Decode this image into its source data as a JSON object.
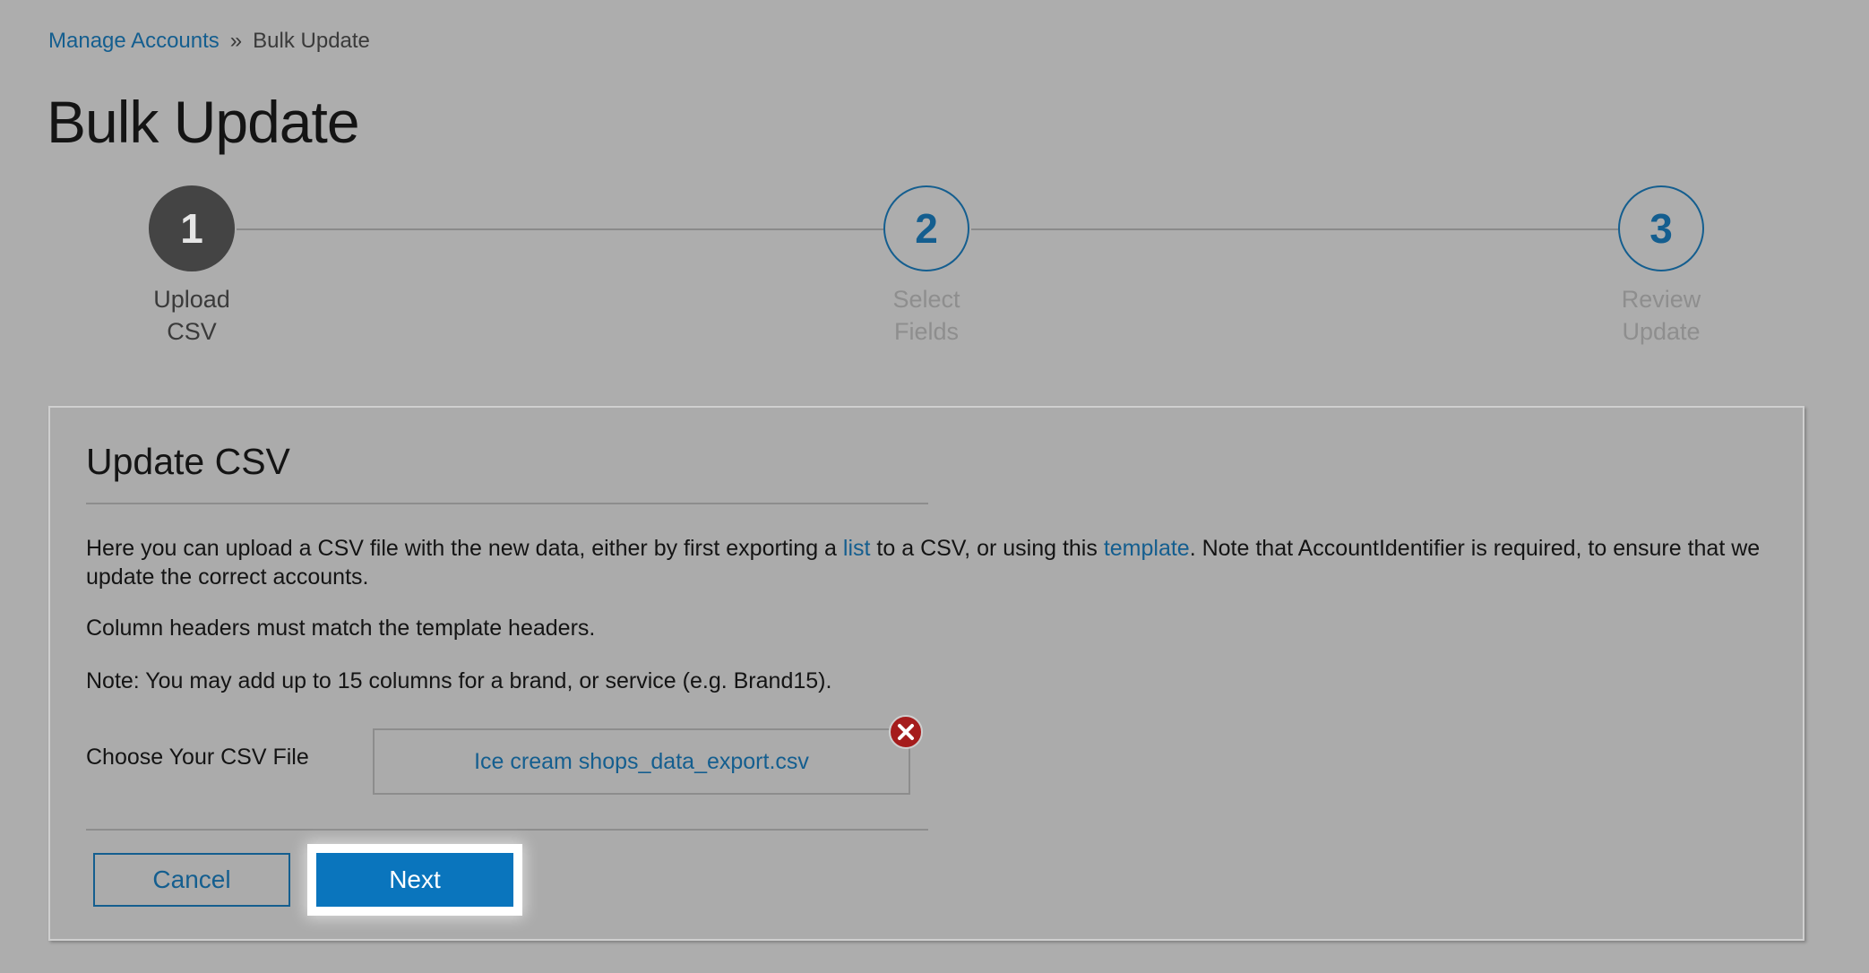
{
  "breadcrumb": {
    "parent": "Manage Accounts",
    "separator": "»",
    "current": "Bulk Update"
  },
  "page_title": "Bulk Update",
  "stepper": {
    "steps": [
      {
        "number": "1",
        "line1": "Upload",
        "line2": "CSV",
        "state": "active"
      },
      {
        "number": "2",
        "line1": "Select",
        "line2": "Fields",
        "state": "pending"
      },
      {
        "number": "3",
        "line1": "Review",
        "line2": "Update",
        "state": "pending"
      }
    ]
  },
  "card": {
    "title": "Update CSV",
    "desc1": {
      "part1": "Here you can upload a CSV file with the new data, either by first exporting a ",
      "link1": "list",
      "part2": " to a CSV, or using this ",
      "link2": "template",
      "part3": ". Note that AccountIdentifier is required, to ensure that we update the correct accounts."
    },
    "desc2": "Column headers must match the template headers.",
    "desc3": "Note: You may add up to 15 columns for a brand, or service (e.g. Brand15).",
    "file_label": "Choose Your CSV File",
    "file_name": "Ice cream shops_data_export.csv",
    "cancel_label": "Cancel",
    "next_label": "Next"
  },
  "colors": {
    "link": "#145e8f",
    "primary_button": "#0a75bd",
    "remove_icon": "#a51c1c"
  },
  "icons": {
    "remove": "close-circle-icon"
  }
}
